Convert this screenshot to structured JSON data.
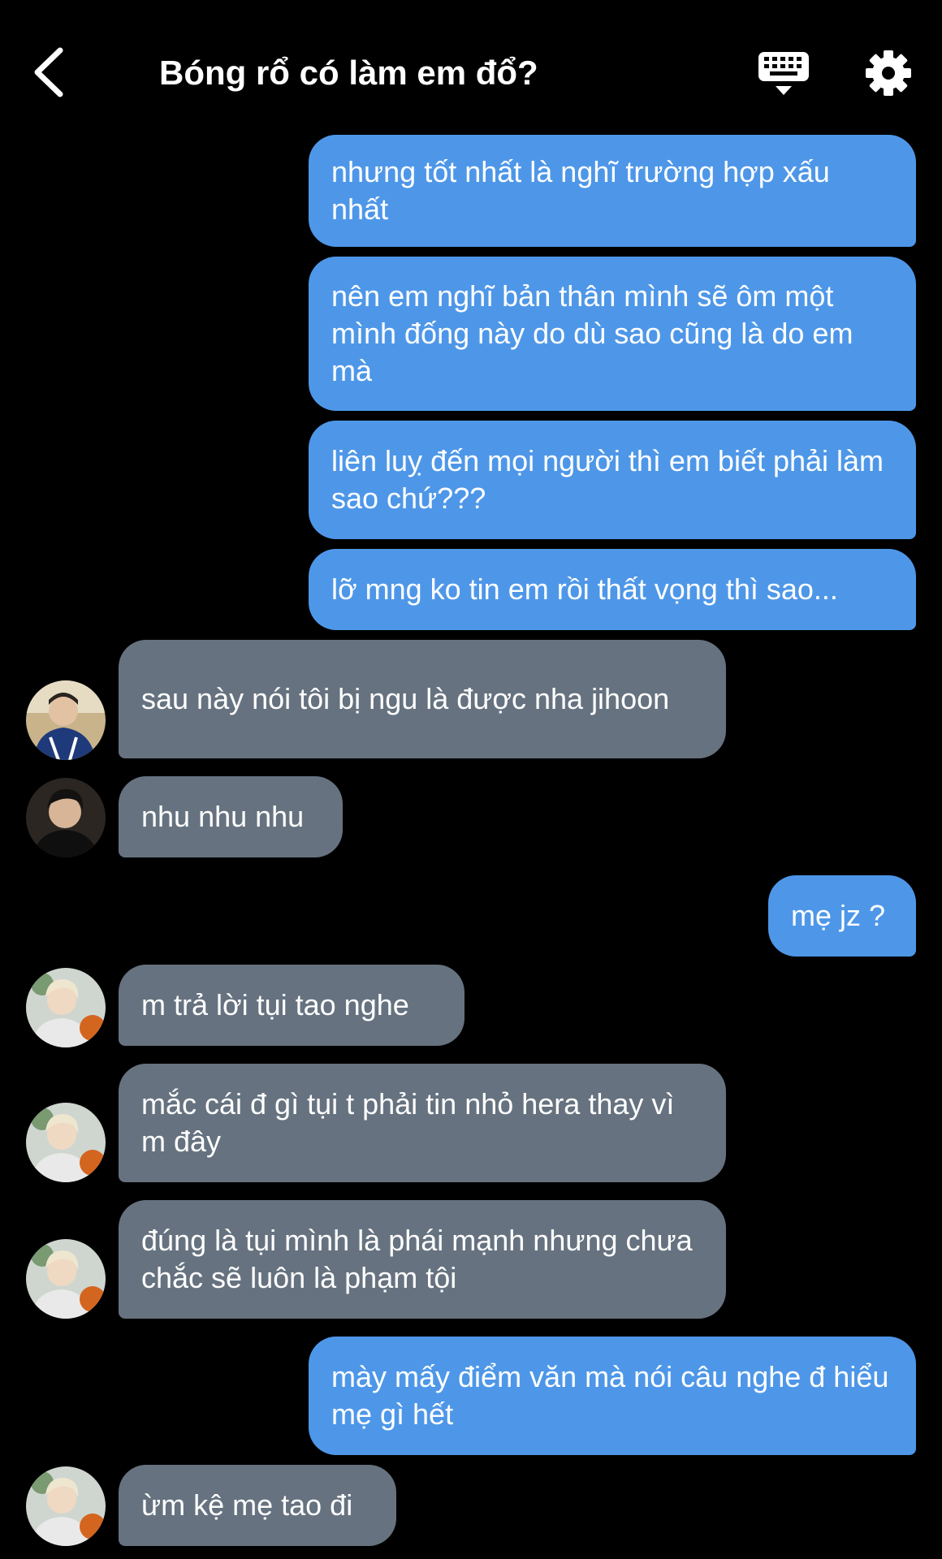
{
  "header": {
    "title": "Bóng rổ có làm em đổ?"
  },
  "messages": [
    {
      "side": "sent",
      "text": "nhưng tốt nhất là nghĩ trường hợp xấu nhất"
    },
    {
      "side": "sent",
      "text": "nên em nghĩ bản thân mình sẽ ôm một mình đống này do dù sao cũng là do em mà"
    },
    {
      "side": "sent",
      "text": "liên luỵ đến mọi người thì em biết phải làm sao chứ???"
    },
    {
      "side": "sent",
      "text": "lỡ mng ko tin em rồi thất vọng thì sao..."
    },
    {
      "side": "received",
      "text": "sau này nói tôi bị ngu là được nha jihoon"
    },
    {
      "side": "received",
      "text": "nhu nhu nhu"
    },
    {
      "side": "sent",
      "text": "mẹ jz ?"
    },
    {
      "side": "received",
      "text": "m trả lời tụi tao nghe"
    },
    {
      "side": "received",
      "text": "mắc cái đ gì tụi t phải tin nhỏ hera thay vì m đây"
    },
    {
      "side": "received",
      "text": "đúng là tụi mình là phái mạnh nhưng chưa chắc sẽ luôn là phạm tội"
    },
    {
      "side": "sent",
      "text": "mày mấy điểm văn mà nói câu nghe đ hiểu mẹ gì hết"
    },
    {
      "side": "received",
      "text": "ừm kệ mẹ tao đi"
    }
  ],
  "colors": {
    "background": "#000000",
    "sent_bubble": "#4e97e8",
    "received_bubble": "#66727f",
    "text": "#ffffff"
  },
  "icons": {
    "back": "chevron-left-icon",
    "keyboard": "keyboard-icon",
    "settings": "gear-icon"
  }
}
